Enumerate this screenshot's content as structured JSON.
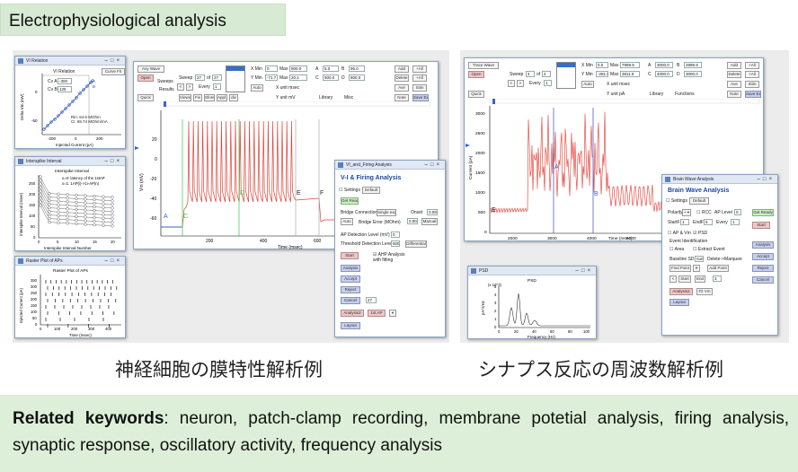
{
  "header_title": "Electrophysiological analysis",
  "captions": {
    "left": "神経細胞の膜特性解析例",
    "right": "シナプス反応の周波数解析例"
  },
  "keywords": {
    "label": "Related keywords",
    "text": ": neuron, patch-clamp recording, membrane potetial analysis, firing analysis, synaptic response, oscillatory activity, frequency analysis"
  },
  "left": {
    "vi_window": {
      "title": "VI Relation",
      "plot_title": "VI Relation",
      "button": "Curve Fit",
      "cv_a_label": "Cv A",
      "cv_a": "-300",
      "cv_b_label": "Cv B",
      "cv_b": "125",
      "xlabel": "Injected Current (pA)",
      "ylabel": "Delta Vm (mV)",
      "xticks": [
        "-200",
        "0",
        "200"
      ],
      "yticks": [
        "0",
        "-50"
      ],
      "note1": "Rin: 64.6 MOhm",
      "note2": "Ci: 69.74 MOhm/mA",
      "marks": [
        "A",
        "B"
      ]
    },
    "isi_window": {
      "title": "Interspike Interval",
      "plot_title": "Interspike Interval",
      "note1": "x=0: latency of the 1stAP",
      "note2": "x=1: 1AP(i)->1i-AP(n)",
      "xlabel": "Interspike Interval Number",
      "ylabel": "Interspike Interval (msec)",
      "xticks": [
        "0",
        "5",
        "10",
        "15",
        "20"
      ],
      "yticks": [
        "0",
        "50",
        "100",
        "150",
        "200",
        "250"
      ]
    },
    "raster_window": {
      "title": "Raster Plot of APs",
      "plot_title": "Raster Plot of APs",
      "xlabel": "Time (msec)",
      "ylabel": "Injected Current (pA)",
      "xticks": [
        "0",
        "100",
        "200",
        "300",
        "400"
      ],
      "yticks": [
        "0",
        "50",
        "100",
        "150",
        "200",
        "250",
        "300",
        "350"
      ]
    },
    "main_window": {
      "wave_select": "Any Wave",
      "sweep_label": "Sweep",
      "sweep": "27",
      "of_label": "of",
      "of": "27",
      "every_label": "Every",
      "every": "1",
      "open_btn": "Open",
      "quick_btn": "Quick",
      "results_label": "Results",
      "sweeps_label": "Sweeps",
      "nav_btns": [
        "Views",
        "Fix",
        "Sfore",
        "Appl.",
        "div"
      ],
      "x_min_label": "X Min",
      "x_min": "0",
      "x_max_label": "Max",
      "x_max": "800.0",
      "y_min_label": "Y Min",
      "y_min": "-71.7",
      "y_max_label": "Max",
      "y_max": "20.1",
      "auto_btn": "Auto",
      "xunit": "X unit msec",
      "yunit": "Y unit mV",
      "cursor_a": "5.0",
      "cursor_b": "95.0",
      "cursor_c": "500.0",
      "cursor_d": "800.0",
      "right_btns": [
        "Add",
        "+All",
        "Delete",
        "+All",
        "Ave",
        "Stim",
        "Note",
        "Save Ex"
      ],
      "library": "Library",
      "misc": "Misc",
      "xlabel": "Time (msec)",
      "ylabel": "Vm (mV)",
      "xticks": [
        "200",
        "400",
        "600"
      ],
      "yticks": [
        "20",
        "0",
        "-20",
        "-40",
        "-60"
      ],
      "markers": [
        "A",
        "C",
        "D",
        "E",
        "F"
      ]
    },
    "fa_window": {
      "title": "VI_and_Firing Analysis",
      "heading": "V-I & Firing Analysis",
      "settings_label": "Settings",
      "settings_value": "Default",
      "get_ready": "Get Ready",
      "bridge_label": "Bridge Connection",
      "bridge_value": "Single exp",
      "onset_label": "Onset",
      "onset": "0.09",
      "auto_btn": "Auto",
      "bridge_err_label": "Bridge Error (MOhm)",
      "bridge_err": "0.00",
      "manual_btn": "Manual",
      "ap_det_label": "AP Detection Level (mV)",
      "ap_det": "0",
      "thr_label": "Threshold Detection Level",
      "thr": "500",
      "diff_btn": "Differential",
      "start_btn": "Start",
      "ahp_label": "AHP Analysis with fitting",
      "analysis_btn": "Analysis",
      "accept_btn": "Accept",
      "reject_btn": "Reject",
      "cancel_btn": "Cancel",
      "num": "27",
      "analysis2_btn": "Analysis2",
      "first_ap_btn": "1st AP",
      "layout_btn": "Layout"
    }
  },
  "right": {
    "main_window": {
      "wave_select": "Trace Wave",
      "sweep_label": "Sweep",
      "sweep": "4",
      "of_label": "of",
      "of": "4",
      "every_label": "Every",
      "every": "1",
      "open_btn": "Open",
      "quick_btn": "Quick",
      "x_min_label": "X Min",
      "x_min": "0.0",
      "x_max_label": "Max",
      "x_max": "7999.9",
      "y_min_label": "Y Min",
      "y_min": "-281.9",
      "y_max_label": "Max",
      "y_max": "3811.9",
      "auto_btn": "Auto",
      "xunit": "X unit msec",
      "yunit": "Y unit pA",
      "cursor_a": "3000.0",
      "cursor_b": "2999.9",
      "cursor_c": "4000.0",
      "cursor_d": "3000.0",
      "right_btns": [
        "Add",
        "+All",
        "Delete",
        "+All",
        "Ave",
        "Stim",
        "Note",
        "Save Ex"
      ],
      "library": "Library",
      "functions": "Functions",
      "xlabel": "Time (msec)",
      "ylabel": "Current (pA)",
      "xticks": [
        "2000",
        "3000",
        "4000",
        "5000"
      ],
      "yticks": [
        "3000",
        "2500",
        "2000",
        "1500",
        "1000",
        "500",
        "0"
      ],
      "markers": [
        "A",
        "B",
        "E"
      ]
    },
    "psd_window": {
      "title": "PSD",
      "plot_title": "PSD",
      "xlabel": "Frequency (Hz)",
      "ylabel": "pA^2/Hz",
      "xticks": [
        "0",
        "20",
        "40",
        "60",
        "80",
        "100"
      ],
      "yticks": [
        "0",
        "1",
        "2",
        "3",
        "4",
        "5"
      ],
      "ymult": "(x 10^3)"
    },
    "bw_window": {
      "title": "Brain Wave Analysis",
      "heading": "Brain Wave Analysis",
      "settings_label": "Settings",
      "settings_value": "Default",
      "polarity_label": "Polarity",
      "rcc_label": "RCC",
      "ap_level_label": "AP Level",
      "ap_level": "0",
      "get_ready": "Get Ready",
      "start_label": "StartF",
      "start": "1",
      "end_label": "EndF",
      "end": "5",
      "every_label": "Every",
      "every": "1",
      "start_btn": "Start",
      "ap_vm_label": "AP & Vm",
      "psd_label": "PSD",
      "event_id_label": "Event Identification",
      "area_label": "Area",
      "extract_label": "Extract Event",
      "analysis_btn": "Analysis",
      "baseline_label": "Baseline SD",
      "baseline": "non",
      "delete_marquee": "Delete->Marquee",
      "accept_btn": "Accept",
      "find_point_btn": "Find Point",
      "add_point_btn": "Add Point",
      "reject_btn": "Reject",
      "start2_btn": "Start",
      "end2_btn": "End",
      "cancel_btn": "Cancel",
      "num": "3",
      "analysis2_btn": "Analysis2",
      "layout_btn": "Layout",
      "fit_btn": "Fit Vm"
    }
  }
}
